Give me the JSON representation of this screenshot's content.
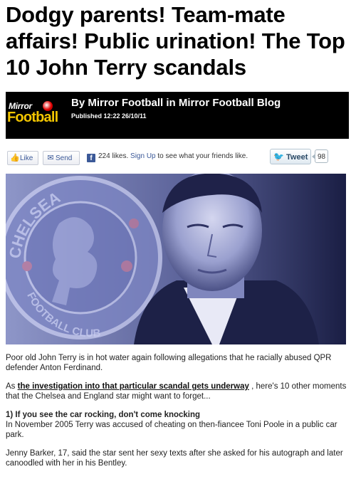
{
  "headline": "Dodgy parents! Team-mate affairs! Public urination! The Top 10 John Terry scandals",
  "byline": {
    "logo_top": "Mirror",
    "logo_bottom": "Football",
    "author": "By Mirror Football in Mirror Football Blog",
    "published": "Published 12:22 26/10/11"
  },
  "social": {
    "like_label": "Like",
    "send_label": "Send",
    "likes_count_text": "224 likes.",
    "signup_label": "Sign Up",
    "signup_suffix": "to see what your friends like.",
    "tweet_label": "Tweet",
    "tweet_count": "98"
  },
  "hero": {
    "crest_text": "CHELSEA FOOTBALL CLUB"
  },
  "article": {
    "p1": "Poor old John Terry is in hot water again following allegations that he racially abused QPR defender Anton Ferdinand.",
    "p2_prefix": "As",
    "p2_link": "the investigation into that particular scandal gets underway",
    "p2_suffix": ", here's 10 other moments that the Chelsea and England star might want to forget...",
    "item1_title": "1) If you see the car rocking, don't come knocking",
    "item1_p1": "In November 2005 Terry was accused of cheating on then-fiancee Toni Poole in a public car park.",
    "item1_p2": "Jenny Barker, 17, said the star sent her sexy texts after she asked for his autograph and later canoodled with her in his Bentley."
  },
  "colors": {
    "byline_bg": "#000000",
    "logo_yellow": "#f2c500",
    "facebook_blue": "#3b5998",
    "twitter_blue": "#33a6e0"
  }
}
